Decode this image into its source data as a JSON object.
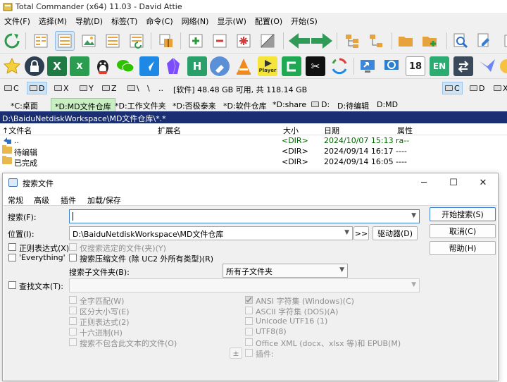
{
  "window": {
    "title": "Total Commander (x64) 11.03 - David Attie"
  },
  "menu": [
    "文件(F)",
    "选择(M)",
    "导航(D)",
    "标签(T)",
    "命令(C)",
    "网络(N)",
    "显示(W)",
    "配置(O)",
    "开始(S)"
  ],
  "toolbar2_labels": {
    "player": "Player",
    "calendar": "18",
    "en": "EN",
    "excel": "X",
    "h": "H",
    "capcut": "✂"
  },
  "drivebar": {
    "left_drives": [
      "C",
      "D",
      "X",
      "Y",
      "Z",
      "\\",
      ".."
    ],
    "right_drives": [
      "C",
      "D",
      "X"
    ],
    "info": "[软件]  48.48 GB 可用, 共 118.14 GB"
  },
  "tabs": [
    "*C:桌面",
    "*D:MD文件仓库",
    "*D:工作文件夹",
    "*D:否极泰来",
    "*D:软件仓库",
    "*D:share",
    "D:",
    "D:待编辑",
    "D:MD"
  ],
  "path": "D:\\BaiduNetdiskWorkspace\\MD文件仓库\\*.*",
  "columns": {
    "name": "↑文件名",
    "ext": "扩展名",
    "size": "大小",
    "date": "日期",
    "attr": "属性"
  },
  "files": [
    {
      "name": "..",
      "size": "<DIR>",
      "date": "2024/10/07 15:13",
      "attr": "ra--"
    },
    {
      "name": "待编辑",
      "size": "<DIR>",
      "date": "2024/09/14 16:17",
      "attr": "----"
    },
    {
      "name": "已完成",
      "size": "<DIR>",
      "date": "2024/09/14 16:05",
      "attr": "----"
    }
  ],
  "dialog": {
    "title": "搜索文件",
    "tabs": [
      "常规",
      "高级",
      "插件",
      "加载/保存"
    ],
    "search_label": "搜索(F):",
    "search_value": "",
    "location_label": "位置(I):",
    "location_value": "D:\\BaiduNetdiskWorkspace\\MD文件仓库",
    "arrows_button": ">>",
    "drives_button": "驱动器(D)",
    "start_button": "开始搜索(S)",
    "cancel_button": "取消(C)",
    "help_button": "帮助(H)",
    "regex_check": "正则表达式(X)",
    "everything_check": "'Everything'",
    "only_selected_check": "仅搜索选定的文件(夹)(Y)",
    "archives_check": "搜索压缩文件 (除 UC2 外所有类型)(R)",
    "subfolder_label": "搜索子文件夹(B):",
    "subfolder_value": "所有子文件夹",
    "find_text_check": "查找文本(T):",
    "text_value": "",
    "left_options": [
      "全字匹配(W)",
      "区分大小写(E)",
      "正则表达式(2)",
      "十六进制(H)",
      "搜索不包含此文本的文件(O)"
    ],
    "right_options": [
      "ANSI 字符集 (Windows)(C)",
      "ASCII 字符集 (DOS)(A)",
      "Unicode UTF16 (1)",
      "UTF8(8)",
      "Office XML (docx、xlsx 等)和 EPUB(M)",
      "插件:"
    ],
    "plus_label": "±"
  }
}
